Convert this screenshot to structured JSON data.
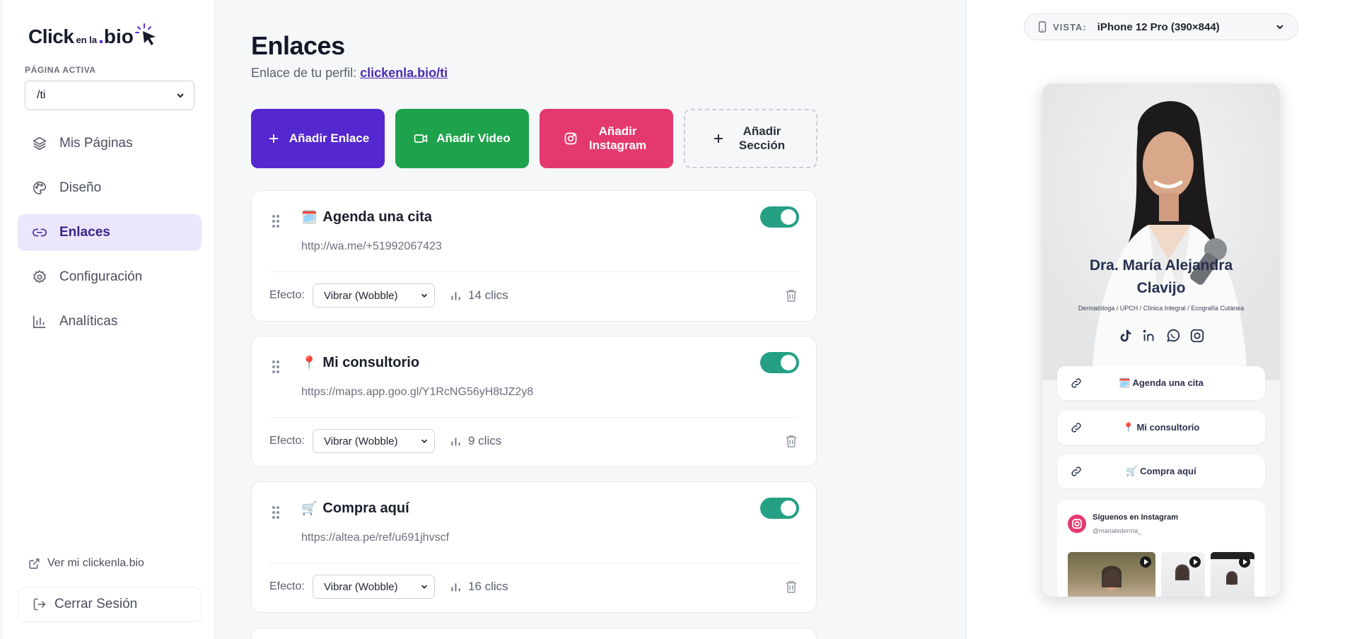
{
  "brand": {
    "part1": "Click",
    "part2": "en la",
    "part3_dot": ".",
    "part3": "bio"
  },
  "sidebar": {
    "active_page_label": "PÁGINA ACTIVA",
    "active_page_value": "/ti",
    "items": [
      {
        "label": "Mis Páginas",
        "icon": "layers-icon"
      },
      {
        "label": "Diseño",
        "icon": "palette-icon"
      },
      {
        "label": "Enlaces",
        "icon": "link-icon",
        "active": true
      },
      {
        "label": "Configuración",
        "icon": "gear-icon"
      },
      {
        "label": "Analíticas",
        "icon": "bar-chart-icon"
      }
    ],
    "view_link": "Ver mi clickenla.bio",
    "logout": "Cerrar Sesión"
  },
  "main": {
    "title": "Enlaces",
    "subtitle_prefix": "Enlace de tu perfil:",
    "profile_url": "clickenla.bio/ti",
    "actions": [
      {
        "label": "Añadir Enlace",
        "icon": "plus-icon",
        "color": "#5427cf"
      },
      {
        "label": "Añadir Video",
        "icon": "video-icon",
        "color": "#1ea24b"
      },
      {
        "label": "Añadir Instagram",
        "icon": "instagram-icon",
        "color": "#e4396f"
      },
      {
        "label": "Añadir Sección",
        "icon": "plus-icon"
      }
    ],
    "effect_label": "Efecto:",
    "links": [
      {
        "emoji": "🗓️",
        "title": "Agenda una cita",
        "url": "http://wa.me/+51992067423",
        "effect": "Vibrar (Wobble)",
        "clicks": "14 clics",
        "enabled": true
      },
      {
        "emoji": "📍",
        "title": "Mi consultorio",
        "url": "https://maps.app.goo.gl/Y1RcNG56yH8tJZ2y8",
        "effect": "Vibrar (Wobble)",
        "clicks": "9 clics",
        "enabled": true
      },
      {
        "emoji": "🛒",
        "title": "Compra aquí",
        "url": "https://altea.pe/ref/u691jhvscf",
        "effect": "Vibrar (Wobble)",
        "clicks": "16 clics",
        "enabled": true
      }
    ]
  },
  "preview": {
    "view_label": "VISTA:",
    "device": "iPhone 12 Pro (390×844)",
    "profile_name_line1": "Dra. María Alejandra",
    "profile_name_line2": "Clavijo",
    "profile_desc": "Dermatóloga / UPCH / Clínica Integral / Ecografía Cutánea",
    "socials": [
      "tiktok-icon",
      "linkedin-icon",
      "whatsapp-icon",
      "instagram-icon"
    ],
    "links": [
      "🗓️ Agenda una cita",
      "📍 Mi consultorio",
      "🛒 Compra aquí"
    ],
    "instagram_title": "Síguenos en Instagram",
    "instagram_handle": "@marialederma_"
  }
}
